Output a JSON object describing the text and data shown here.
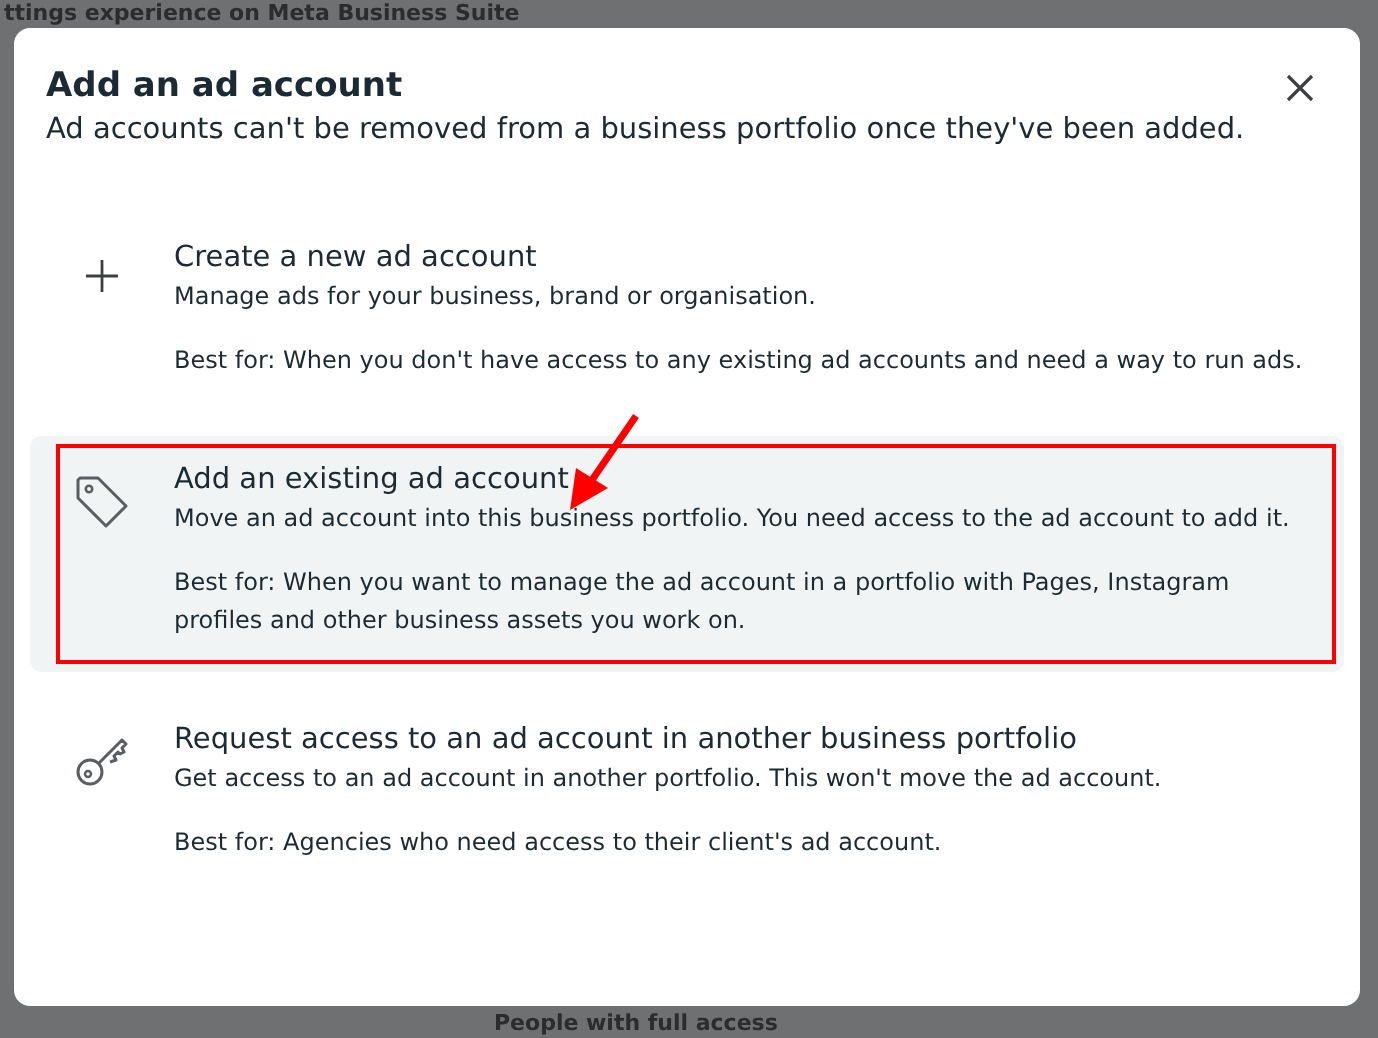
{
  "background": {
    "heading": "ttings experience on Meta Business Suite",
    "footer_heading": "People with full access"
  },
  "dialog": {
    "title": "Add an ad account",
    "subtitle": "Ad accounts can't be removed from a business portfolio once they've been added.",
    "options": [
      {
        "kind": "plus",
        "selected": false,
        "annotated": false,
        "title": "Create a new ad account",
        "description": "Manage ads for your business, brand or organisation.",
        "best_for": "Best for: When you don't have access to any existing ad accounts and need a way to run ads."
      },
      {
        "kind": "tag",
        "selected": true,
        "annotated": true,
        "title": "Add an existing ad account",
        "description": "Move an ad account into this business portfolio. You need access to the ad account to add it.",
        "best_for": "Best for: When you want to manage the ad account in a portfolio with Pages, Instagram profiles and other business assets you work on."
      },
      {
        "kind": "key",
        "selected": false,
        "annotated": false,
        "title": "Request access to an ad account in another business portfolio",
        "description": "Get access to an ad account in another portfolio. This won't move the ad account.",
        "best_for": "Best for: Agencies who need access to their client's ad account."
      }
    ]
  }
}
